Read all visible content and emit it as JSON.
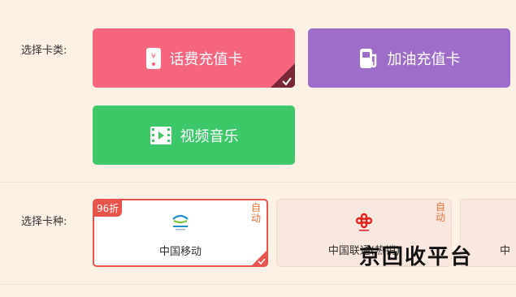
{
  "card_type": {
    "label": "选择卡类:",
    "options": [
      {
        "label": "话费充值卡",
        "color": "#f7667f",
        "icon": "phone-bill-icon",
        "selected": true
      },
      {
        "label": "加油充值卡",
        "color": "#9d6ec9",
        "icon": "fuel-pump-icon",
        "selected": false
      },
      {
        "label": "视频音乐",
        "color": "#3ec869",
        "icon": "video-film-icon",
        "selected": false
      }
    ]
  },
  "card_kind": {
    "label": "选择卡种:",
    "carriers": [
      {
        "name": "中国移动",
        "discount": "96折",
        "tag": "自动",
        "icon": "china-mobile-logo-icon",
        "selected": true
      },
      {
        "name": "中国联通(热销)",
        "tag": "自动",
        "icon": "china-unicom-logo-icon",
        "selected": false
      },
      {
        "name": "中",
        "selected": false
      }
    ]
  },
  "watermark": "京回收平台",
  "colors": {
    "background": "#fdf1e6",
    "accent": "#e8534a",
    "auto_tag": "#e8743b"
  }
}
